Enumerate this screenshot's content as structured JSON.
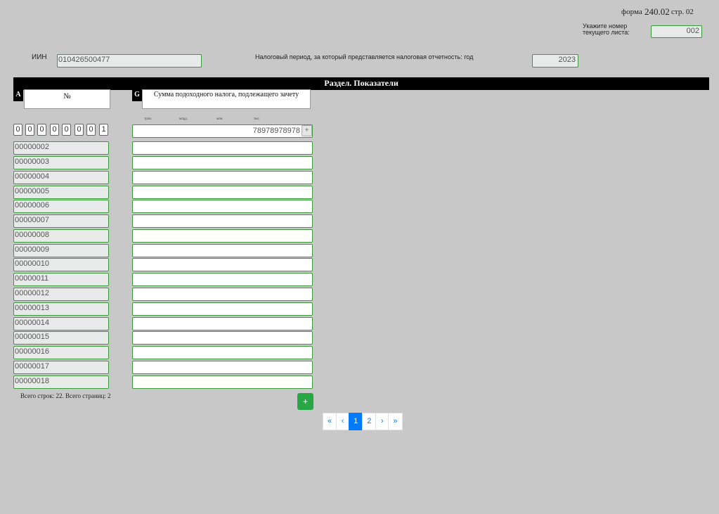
{
  "header": {
    "form_label": "форма",
    "form_number": "240.02",
    "page_label": "стр. 02",
    "sheet_prompt_line1": "Укажите номер",
    "sheet_prompt_line2": "текущего листа:",
    "sheet_number": "002"
  },
  "taxpayer": {
    "iin_label": "ИИН",
    "iin_value": "010426500477",
    "period_label": "Налоговый период, за который представляется налоговая отчетность: год",
    "year_value": "2023"
  },
  "section": {
    "title": "Раздел. Показатели",
    "col_a_letter": "A",
    "col_a_header": "№",
    "col_g_letter": "G",
    "col_g_header": "Сумма подоходного налога, подлежащего зачету",
    "units": [
      "трлн.",
      "млрд.",
      "млн.",
      "тыс."
    ]
  },
  "rows": {
    "first_number_digits": [
      "0",
      "0",
      "0",
      "0",
      "0",
      "0",
      "0",
      "1"
    ],
    "first_amount": "78978978978",
    "plus_label": "+",
    "numbers": [
      "00000002",
      "00000003",
      "00000004",
      "00000005",
      "00000006",
      "00000007",
      "00000008",
      "00000009",
      "00000010",
      "00000011",
      "00000012",
      "00000013",
      "00000014",
      "00000015",
      "00000016",
      "00000017",
      "00000018"
    ]
  },
  "footer": {
    "summary": "Всего строк: 22. Всего страниц: 2",
    "add_button": "+"
  },
  "pagination": {
    "first": "«",
    "prev": "‹",
    "pages": [
      "1",
      "2"
    ],
    "current_page": 1,
    "next": "›",
    "last": "»"
  },
  "colors": {
    "background": "#c8c8c8",
    "field_border": "#3c9a3c",
    "add_button": "#28a745",
    "active_page": "#007bff"
  }
}
